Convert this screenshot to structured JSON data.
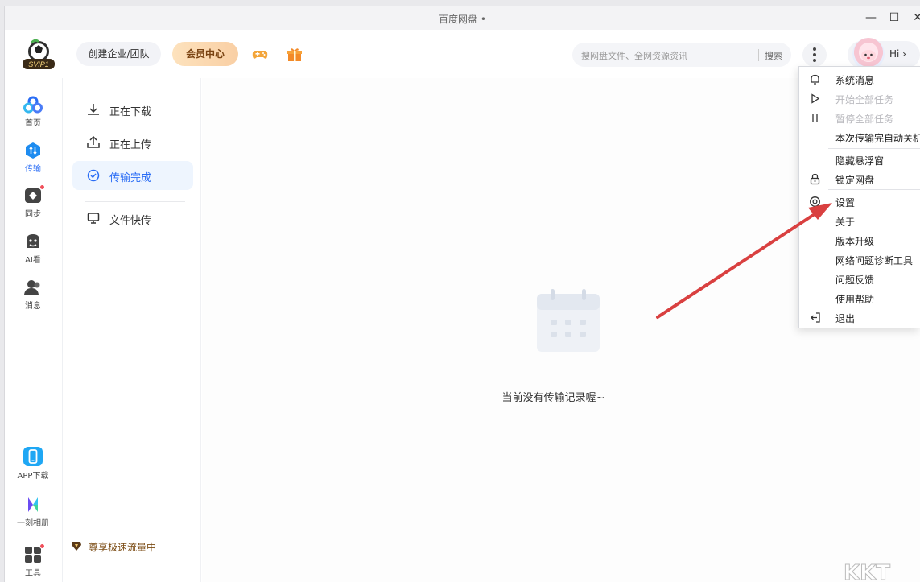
{
  "window": {
    "title": "百度网盘 •",
    "controls": [
      "—",
      "☐",
      "✕"
    ]
  },
  "header": {
    "logo_text": "SVIP1",
    "team_label": "创建企业/团队",
    "vip_label": "会员中心",
    "search_placeholder": "搜网盘文件、全网资源资讯",
    "search_button": "搜索",
    "user_greeting": "Hi ›"
  },
  "rail": {
    "items": [
      {
        "label": "首页",
        "icon": "home-icon"
      },
      {
        "label": "传输",
        "icon": "transfer-icon",
        "active": true
      },
      {
        "label": "同步",
        "icon": "sync-icon"
      },
      {
        "label": "AI看",
        "icon": "ai-look-icon"
      },
      {
        "label": "消息",
        "icon": "message-icon"
      }
    ],
    "bottom": [
      {
        "label": "APP下载",
        "icon": "phone-icon"
      },
      {
        "label": "一刻相册",
        "icon": "album-icon"
      },
      {
        "label": "工具",
        "icon": "tools-icon"
      }
    ]
  },
  "transfer_nav": {
    "items": [
      {
        "label": "正在下载",
        "icon": "download-icon"
      },
      {
        "label": "正在上传",
        "icon": "upload-icon"
      },
      {
        "label": "传输完成",
        "icon": "check-circle-icon",
        "active": true
      },
      {
        "label": "文件快传",
        "icon": "monitor-icon"
      }
    ],
    "flow_label": "尊享极速流量中"
  },
  "main": {
    "empty_text": "当前没有传输记录喔~"
  },
  "menu": {
    "items": [
      {
        "label": "系统消息",
        "icon": "bell-icon"
      },
      {
        "label": "开始全部任务",
        "icon": "play-icon",
        "disabled": true
      },
      {
        "label": "暂停全部任务",
        "icon": "pause-icon",
        "disabled": true
      },
      {
        "label": "本次传输完自动关机",
        "icon": ""
      },
      {
        "label": "隐藏悬浮窗",
        "icon": ""
      },
      {
        "label": "锁定网盘",
        "icon": "lock-icon"
      },
      {
        "label": "设置",
        "icon": "settings-icon"
      },
      {
        "label": "关于",
        "icon": ""
      },
      {
        "label": "版本升级",
        "icon": ""
      },
      {
        "label": "网络问题诊断工具",
        "icon": ""
      },
      {
        "label": "问题反馈",
        "icon": ""
      },
      {
        "label": "使用帮助",
        "icon": ""
      },
      {
        "label": "退出",
        "icon": "exit-icon"
      }
    ]
  },
  "colors": {
    "accent": "#2a6df5",
    "vip": "#f9cfa4",
    "arrow": "#d94040"
  }
}
